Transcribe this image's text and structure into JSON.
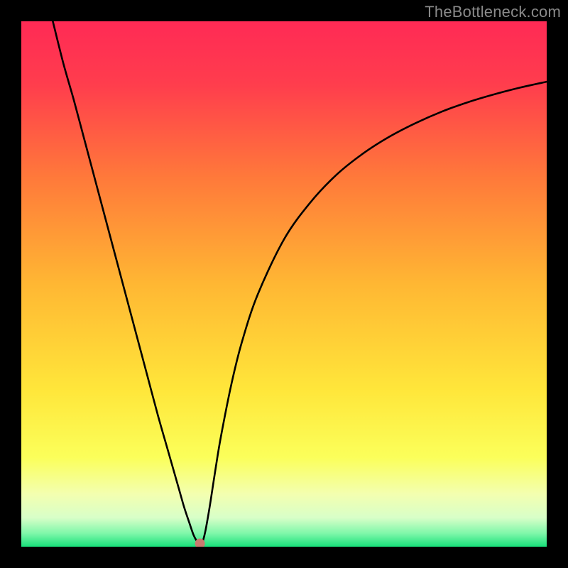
{
  "watermark": "TheBottleneck.com",
  "chart_data": {
    "type": "line",
    "title": "",
    "xlabel": "",
    "ylabel": "",
    "xlim": [
      0,
      100
    ],
    "ylim": [
      0,
      100
    ],
    "background_gradient_stops": [
      {
        "offset": 0.0,
        "color": "#ff2a55"
      },
      {
        "offset": 0.12,
        "color": "#ff3d4d"
      },
      {
        "offset": 0.3,
        "color": "#ff7a3a"
      },
      {
        "offset": 0.5,
        "color": "#ffb733"
      },
      {
        "offset": 0.7,
        "color": "#ffe63a"
      },
      {
        "offset": 0.83,
        "color": "#fbff5a"
      },
      {
        "offset": 0.9,
        "color": "#f3ffb0"
      },
      {
        "offset": 0.945,
        "color": "#d8ffc8"
      },
      {
        "offset": 0.975,
        "color": "#7ef7a9"
      },
      {
        "offset": 1.0,
        "color": "#18e07a"
      }
    ],
    "series": [
      {
        "name": "bottleneck-curve",
        "x": [
          6,
          8,
          10,
          12,
          14,
          16,
          18,
          20,
          22,
          24,
          26,
          28,
          30,
          31,
          32,
          32.8,
          33.5,
          34,
          34.5,
          35,
          35.5,
          36,
          37,
          38,
          40,
          42,
          45,
          50,
          55,
          60,
          65,
          70,
          75,
          80,
          85,
          90,
          95,
          100
        ],
        "y": [
          100,
          92,
          85,
          77.5,
          70,
          62.5,
          55,
          47.5,
          40,
          32.5,
          25,
          18,
          11,
          7.5,
          4.5,
          2.2,
          0.9,
          0.2,
          0.9,
          2.8,
          5.5,
          8.5,
          15,
          21,
          31,
          39,
          48,
          58.5,
          65.5,
          70.8,
          74.8,
          78,
          80.6,
          82.8,
          84.6,
          86.1,
          87.4,
          88.5
        ]
      }
    ],
    "marker": {
      "x": 34,
      "y": 0.6,
      "color": "#c97a6f",
      "radius_px": 7
    }
  }
}
